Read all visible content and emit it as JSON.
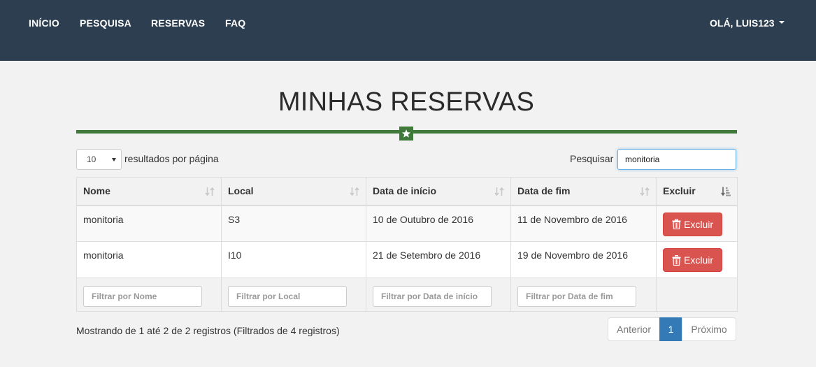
{
  "nav": {
    "items": [
      {
        "label": "INÍCIO"
      },
      {
        "label": "PESQUISA"
      },
      {
        "label": "RESERVAS"
      },
      {
        "label": "FAQ"
      }
    ],
    "user_label": "OLÁ, LUIS123"
  },
  "page": {
    "title": "MINHAS RESERVAS"
  },
  "controls": {
    "length_value": "10",
    "length_label": "resultados por página",
    "search_label": "Pesquisar",
    "search_value": "monitoria"
  },
  "table": {
    "headers": [
      "Nome",
      "Local",
      "Data de início",
      "Data de fim",
      "Excluir"
    ],
    "rows": [
      {
        "nome": "monitoria",
        "local": "S3",
        "inicio": "10 de Outubro de 2016",
        "fim": "11 de Novembro de 2016",
        "action": "Excluir"
      },
      {
        "nome": "monitoria",
        "local": "I10",
        "inicio": "21 de Setembro de 2016",
        "fim": "19 de Novembro de 2016",
        "action": "Excluir"
      }
    ],
    "filters": [
      "Filtrar por Nome",
      "Filtrar por Local",
      "Filtrar por Data de início",
      "Filtrar por Data de fim"
    ]
  },
  "footer": {
    "info": "Mostrando de 1 até 2 de 2 registros (Filtrados de 4 registros)",
    "prev": "Anterior",
    "current_page": "1",
    "next": "Próximo"
  },
  "colors": {
    "navbar": "#2c3e50",
    "accent_green": "#3f7a3a",
    "danger": "#d9534f",
    "primary": "#337ab7"
  },
  "icons": {
    "sort": "sort-icon",
    "sort_active": "sort-amount-desc-icon",
    "trash": "trash-icon",
    "star": "star-icon",
    "caret": "caret-down-icon"
  }
}
